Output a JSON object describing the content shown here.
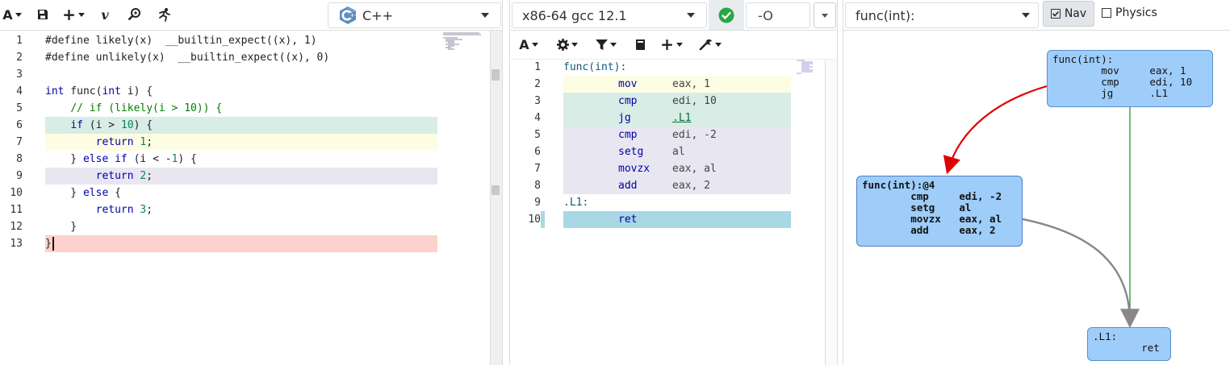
{
  "editor": {
    "toolbar": {
      "font_label": "A",
      "add_label": "+",
      "vim_label": "v"
    },
    "language": "C++",
    "lines": [
      {
        "n": "1",
        "tokens": [
          [
            "",
            "#define likely(x)  __builtin_expect((x), 1)"
          ]
        ]
      },
      {
        "n": "2",
        "tokens": [
          [
            "",
            "#define unlikely(x)  __builtin_expect((x), 0)"
          ]
        ]
      },
      {
        "n": "3",
        "tokens": []
      },
      {
        "n": "4",
        "tokens": [
          [
            "kw",
            "int"
          ],
          [
            "",
            " func("
          ],
          [
            "kw",
            "int"
          ],
          [
            "",
            " i) {"
          ]
        ]
      },
      {
        "n": "5",
        "tokens": [
          [
            "",
            "    "
          ],
          [
            "cm",
            "// if (likely(i > 10)) {"
          ]
        ]
      },
      {
        "n": "6",
        "tokens": [
          [
            "",
            "    "
          ],
          [
            "kw",
            "if"
          ],
          [
            "",
            " (i > "
          ],
          [
            "nm",
            "10"
          ],
          [
            "",
            ") {"
          ]
        ]
      },
      {
        "n": "7",
        "tokens": [
          [
            "",
            "        "
          ],
          [
            "kw",
            "return"
          ],
          [
            "",
            " "
          ],
          [
            "nm",
            "1"
          ],
          [
            "",
            ";"
          ]
        ]
      },
      {
        "n": "8",
        "tokens": [
          [
            "",
            "    } "
          ],
          [
            "kw",
            "else if"
          ],
          [
            "",
            " (i < -"
          ],
          [
            "nm",
            "1"
          ],
          [
            "",
            ") {"
          ]
        ]
      },
      {
        "n": "9",
        "tokens": [
          [
            "",
            "        "
          ],
          [
            "kw",
            "return"
          ],
          [
            "",
            " "
          ],
          [
            "nm",
            "2"
          ],
          [
            "",
            ";"
          ]
        ]
      },
      {
        "n": "10",
        "tokens": [
          [
            "",
            "    } "
          ],
          [
            "kw",
            "else"
          ],
          [
            "",
            " {"
          ]
        ]
      },
      {
        "n": "11",
        "tokens": [
          [
            "",
            "        "
          ],
          [
            "kw",
            "return"
          ],
          [
            "",
            " "
          ],
          [
            "nm",
            "3"
          ],
          [
            "",
            ";"
          ]
        ]
      },
      {
        "n": "12",
        "tokens": [
          [
            "",
            "    }"
          ]
        ]
      },
      {
        "n": "13",
        "tokens": [
          [
            "",
            "}"
          ]
        ]
      }
    ],
    "highlight_colors": {
      "6": "#d7ede6",
      "7": "#fdfde3",
      "8": "",
      "9": "#e8e6f0",
      "13": "#fdd1cd"
    }
  },
  "compiler": {
    "name": "x86-64 gcc 12.1",
    "status": "ok",
    "options": "-O",
    "lines": [
      {
        "n": "1",
        "label": "func(int):",
        "op": "",
        "args": "",
        "bg": ""
      },
      {
        "n": "2",
        "label": "",
        "op": "mov",
        "args": "eax, 1",
        "bg": "#fdfde3"
      },
      {
        "n": "3",
        "label": "",
        "op": "cmp",
        "args": "edi, 10",
        "bg": "#d7ede6"
      },
      {
        "n": "4",
        "label": "",
        "op": "jg",
        "args": ".L1",
        "bg": "#d7ede6"
      },
      {
        "n": "5",
        "label": "",
        "op": "cmp",
        "args": "edi, -2",
        "bg": "#e8e6f0"
      },
      {
        "n": "6",
        "label": "",
        "op": "setg",
        "args": "al",
        "bg": "#e8e6f0"
      },
      {
        "n": "7",
        "label": "",
        "op": "movzx",
        "args": "eax, al",
        "bg": "#e8e6f0"
      },
      {
        "n": "8",
        "label": "",
        "op": "add",
        "args": "eax, 2",
        "bg": "#e8e6f0"
      },
      {
        "n": "9",
        "label": ".L1:",
        "op": "",
        "args": "",
        "bg": ""
      },
      {
        "n": "10",
        "label": "",
        "op": "ret",
        "args": "",
        "bg": "#a8d8e4"
      }
    ]
  },
  "graph": {
    "function": "func(int):",
    "nav_label": "Nav",
    "physics_label": "Physics",
    "nodes": {
      "entry": {
        "title": "func(int):",
        "body": "        mov     eax, 1\n        cmp     edi, 10\n        jg      .L1"
      },
      "block4": {
        "title": "func(int):@4",
        "body": "        cmp     edi, -2\n        setg    al\n        movzx   eax, al\n        add     eax, 2"
      },
      "l1": {
        "title": ".L1:",
        "body": "        ret"
      }
    },
    "edge_colors": {
      "taken": "#e00000",
      "fallthrough": "#1a8a1a",
      "unconditional": "#888888"
    }
  }
}
